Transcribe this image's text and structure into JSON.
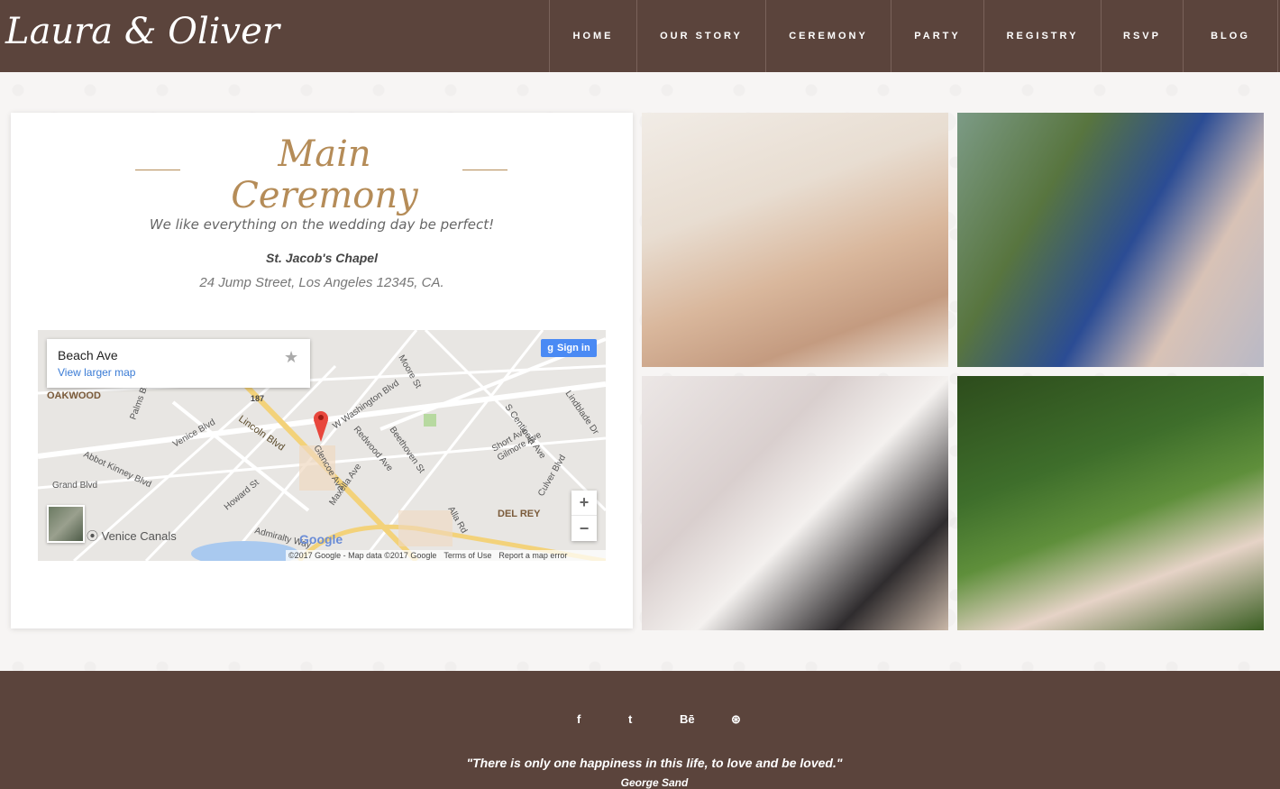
{
  "header": {
    "logo": "Laura & Oliver",
    "nav": [
      {
        "label": "HOME"
      },
      {
        "label": "OUR STORY"
      },
      {
        "label": "CEREMONY"
      },
      {
        "label": "PARTY"
      },
      {
        "label": "REGISTRY"
      },
      {
        "label": "RSVP"
      },
      {
        "label": "BLOG"
      }
    ]
  },
  "ceremony": {
    "title": "Main Ceremony",
    "subtitle": "We like everything on the wedding day be perfect!",
    "venue": "St. Jacob's Chapel",
    "address": "24 Jump Street, Los Angeles 12345, CA."
  },
  "map": {
    "place_name": "Beach Ave",
    "view_larger": "View larger map",
    "signin": "Sign in",
    "zoom_in": "+",
    "zoom_out": "−",
    "google": "Google",
    "venice_canals": "Venice Canals",
    "footer": {
      "copyright": "©2017 Google - Map data ©2017 Google",
      "terms": "Terms of Use",
      "report": "Report a map error"
    },
    "labels": [
      "OAKWOOD",
      "DEL REY",
      "Lincoln Blvd",
      "W Washington Blvd",
      "Abbot Kinney Blvd",
      "Venice Blvd",
      "Grand Blvd",
      "Redwood Ave",
      "Maxella Ave",
      "Glencoe Ave",
      "Beethoven St",
      "Short Ave",
      "Gilmore Ave",
      "Culver Blvd",
      "Alla Rd",
      "Admiralty Way",
      "Palms Blvd",
      "Moore St",
      "Lindblade Dr",
      "S Centinela Ave",
      "Howard St",
      "187"
    ]
  },
  "footer": {
    "social": [
      "f",
      "t",
      "Bē",
      "⊛"
    ],
    "quote": "\"There is only one happiness in this life, to love and be loved.\"",
    "author": "George Sand"
  }
}
